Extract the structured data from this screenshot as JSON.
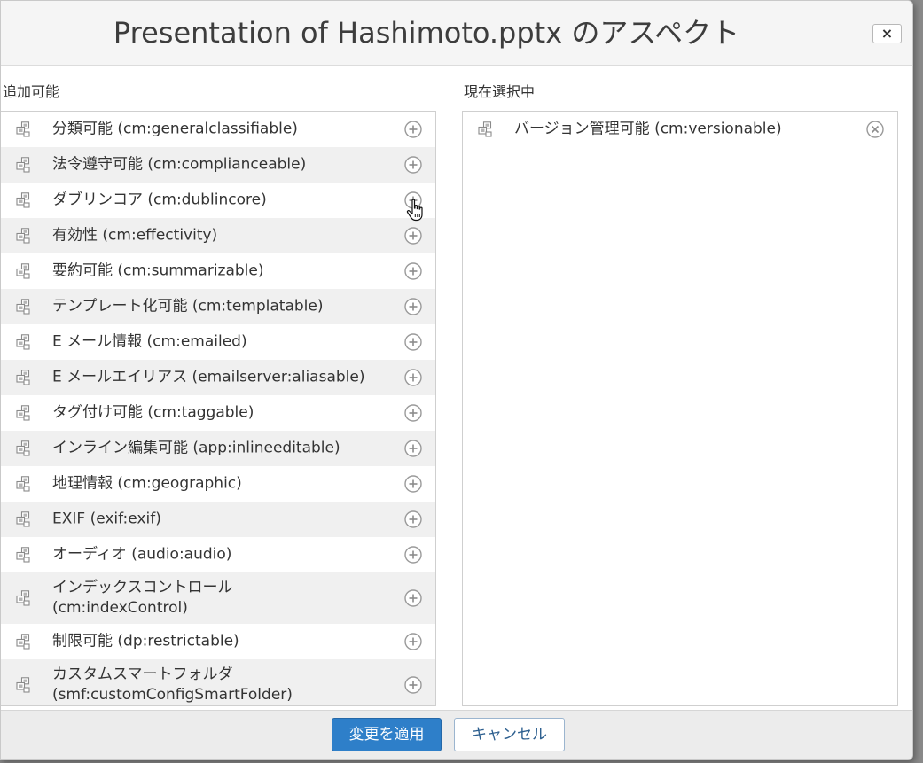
{
  "dialog": {
    "title": "Presentation of Hashimoto.pptx のアスペクト",
    "close_label": "×"
  },
  "available": {
    "label": "追加可能",
    "items": [
      {
        "label": "分類可能 (cm:generalclassifiable)"
      },
      {
        "label": "法令遵守可能 (cm:complianceable)"
      },
      {
        "label": "ダブリンコア (cm:dublincore)"
      },
      {
        "label": "有効性 (cm:effectivity)"
      },
      {
        "label": "要約可能 (cm:summarizable)"
      },
      {
        "label": "テンプレート化可能 (cm:templatable)"
      },
      {
        "label": "E メール情報 (cm:emailed)"
      },
      {
        "label": "E メールエイリアス (emailserver:aliasable)"
      },
      {
        "label": "タグ付け可能 (cm:taggable)"
      },
      {
        "label": "インライン編集可能 (app:inlineeditable)"
      },
      {
        "label": "地理情報 (cm:geographic)"
      },
      {
        "label": "EXIF (exif:exif)"
      },
      {
        "label": "オーディオ (audio:audio)"
      },
      {
        "label": "インデックスコントロール",
        "label2": "(cm:indexControl)"
      },
      {
        "label": "制限可能 (dp:restrictable)"
      },
      {
        "label": "カスタムスマートフォルダ",
        "label2": "(smf:customConfigSmartFolder)"
      }
    ]
  },
  "selected": {
    "label": "現在選択中",
    "items": [
      {
        "label": "バージョン管理可能 (cm:versionable)"
      }
    ]
  },
  "footer": {
    "apply_label": "変更を適用",
    "cancel_label": "キャンセル"
  },
  "colors": {
    "accent": "#2e7fc9",
    "row_alt": "#f0f0f0"
  }
}
